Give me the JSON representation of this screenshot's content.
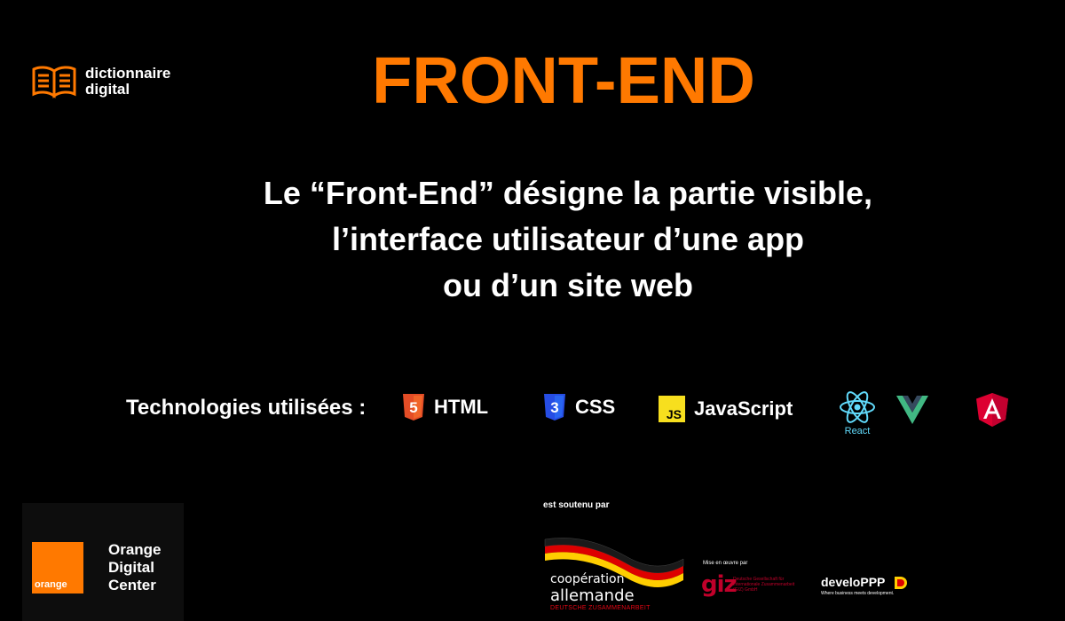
{
  "brand": {
    "line1": "dictionnaire",
    "line2": "digital"
  },
  "title": "FRONT-END",
  "description": {
    "line1": "Le “Front-End”  désigne la partie visible,",
    "line2": "l’interface utilisateur d’une app",
    "line3": "ou d’un site web"
  },
  "technologies": {
    "label": "Technologies utilisées :",
    "items": [
      {
        "name": "HTML",
        "icon": "html5-icon",
        "color": "#e44d26"
      },
      {
        "name": "CSS",
        "icon": "css3-icon",
        "color": "#264de4"
      },
      {
        "name": "JavaScript",
        "icon": "js-icon",
        "color": "#f7df1e"
      },
      {
        "name": "React",
        "icon": "react-icon",
        "color": "#61dafb"
      },
      {
        "name": "",
        "icon": "vue-icon",
        "color": "#41b883"
      },
      {
        "name": "",
        "icon": "angular-icon",
        "color": "#dd0031"
      }
    ]
  },
  "orange_center": {
    "logo_word": "orange",
    "line1": "Orange",
    "line2": "Digital",
    "line3": "Center",
    "color": "#ff7900"
  },
  "support": {
    "label": "est soutenu par",
    "cooperation": {
      "line1": "coopération",
      "line2": "allemande",
      "line3": "DEUTSCHE ZUSAMMENARBEIT"
    },
    "giz": {
      "label": "Mise en œuvre par",
      "logo": "giz",
      "sub": "Deutsche Gesellschaft für Internationale Zusammenarbeit (GIZ) GmbH"
    },
    "developpp": {
      "name": "develoPPP",
      "tagline": "Where business meets development."
    }
  },
  "colors": {
    "accent": "#ff7900",
    "background": "#000000",
    "text": "#ffffff"
  }
}
